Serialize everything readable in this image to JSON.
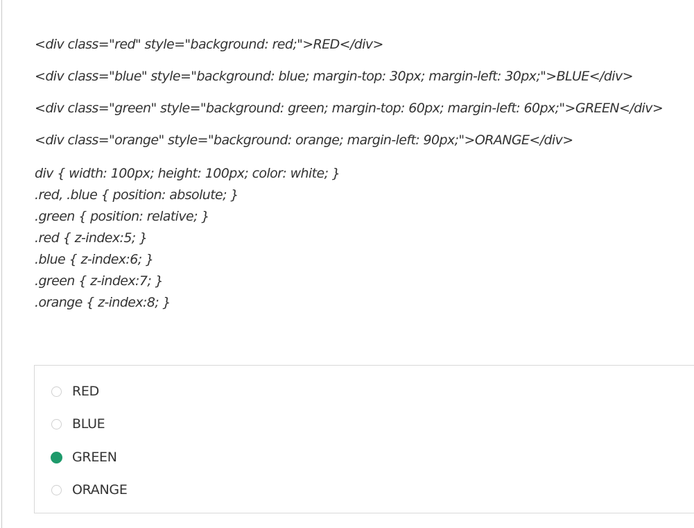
{
  "question": {
    "html_lines": [
      "<div class=\"red\" style=\"background: red;\">RED</div>",
      "<div class=\"blue\" style=\"background: blue; margin-top: 30px; margin-left: 30px;\">BLUE</div>",
      "<div class=\"green\" style=\"background: green; margin-top: 60px; margin-left: 60px;\">GREEN</div>",
      "<div class=\"orange\" style=\"background: orange; margin-left: 90px;\">ORANGE</div>"
    ],
    "css_lines": [
      "div { width: 100px; height: 100px; color: white; }",
      ".red, .blue { position: absolute; }",
      ".green { position: relative; }",
      ".red { z-index:5; }",
      ".blue { z-index:6; }",
      ".green { z-index:7; }",
      ".orange { z-index:8; }"
    ]
  },
  "answer_options": {
    "selected": "GREEN",
    "items": [
      {
        "label": "RED",
        "checked": false
      },
      {
        "label": "BLUE",
        "checked": false
      },
      {
        "label": "GREEN",
        "checked": true
      },
      {
        "label": "ORANGE",
        "checked": false
      }
    ]
  },
  "colors": {
    "selected_radio": "#1e9a6b",
    "text": "#333333",
    "border": "#d8d8d8"
  }
}
